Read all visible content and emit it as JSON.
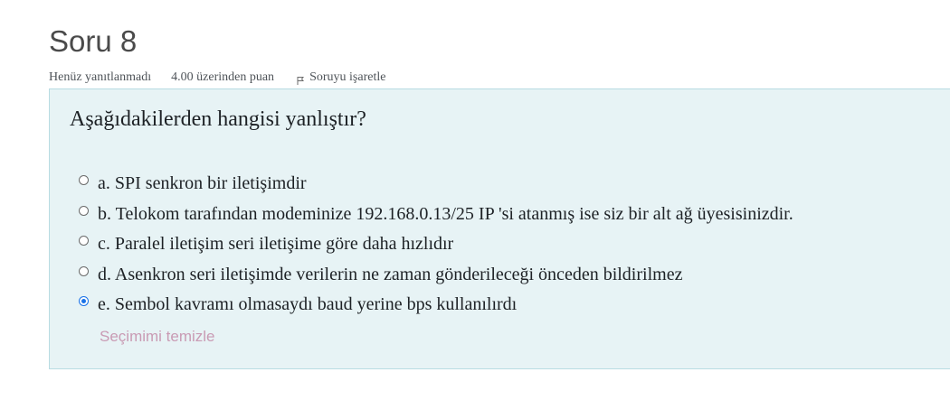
{
  "question": {
    "title": "Soru 8",
    "state": "Henüz yanıtlanmadı",
    "grade": "4.00 üzerinden puan",
    "flag_label": "Soruyu işaretle",
    "text": "Aşağıdakilerden hangisi yanlıştır?",
    "answers": [
      {
        "label": "a. SPI senkron bir iletişimdir",
        "checked": false
      },
      {
        "label": "b. Telokom tarafından modeminize 192.168.0.13/25 IP 'si atanmış ise siz bir alt ağ üyesisinizdir.",
        "checked": false
      },
      {
        "label": "c. Paralel iletişim seri iletişime göre daha hızlıdır",
        "checked": false
      },
      {
        "label": "d. Asenkron seri iletişimde verilerin ne zaman gönderileceği önceden bildirilmez",
        "checked": false
      },
      {
        "label": "e. Sembol kavramı olmasaydı baud yerine bps kullanılırdı",
        "checked": true
      }
    ],
    "clear_choice_label": "Seçimimi temizle"
  },
  "colors": {
    "panel_background": "#e7f3f5",
    "panel_border": "#b8dce2",
    "selected_radio": "#1a73e8",
    "clear_link": "#c99bb4"
  },
  "icons": {
    "flag": "flag-outline-icon"
  }
}
